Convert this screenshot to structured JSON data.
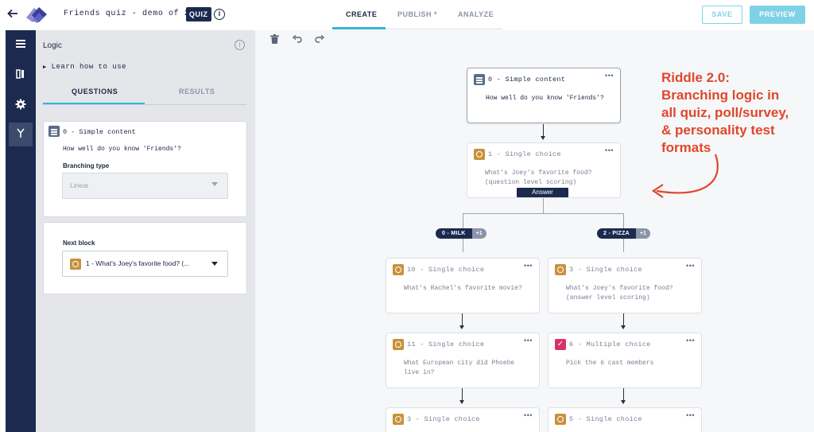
{
  "header": {
    "title": "Friends quiz - demo of 2.0",
    "badge": "QUIZ",
    "info": "i",
    "tabs": [
      "CREATE",
      "PUBLISH *",
      "ANALYZE"
    ],
    "save_label": "SAVE",
    "preview_label": "PREVIEW"
  },
  "colors": {
    "brand_dark": "#1b2a4e",
    "accent": "#37b7d6",
    "button_light": "#7fd2e6",
    "annotation": "#e0472a",
    "single_choice": "#c8913b",
    "multiple_choice": "#d6336c"
  },
  "rail": {
    "icons": [
      "blocks-icon",
      "design-icon",
      "settings-icon",
      "logic-icon"
    ],
    "active": "logic-icon"
  },
  "panel": {
    "title": "Logic",
    "learn": "Learn how to use",
    "tabs": [
      "QUESTIONS",
      "RESULTS"
    ],
    "card1": {
      "title": "0 - Simple content",
      "question": "How well do you know 'Friends'?",
      "branching_label": "Branching type",
      "branching_value": "Linear"
    },
    "card2": {
      "next_label": "Next block",
      "next_value": "1 - What's Joey's favorite food? (..."
    }
  },
  "canvas": {
    "nodes": [
      {
        "id": "n0",
        "title": "0 - Simple content",
        "body": [
          "How well do you know 'Friends'?"
        ],
        "icon": "simple"
      },
      {
        "id": "n1",
        "title": "1 - Single choice",
        "body": [
          "What's Joey's favorite food?",
          "(question level scoring)"
        ],
        "icon": "single"
      },
      {
        "id": "n10",
        "title": "10 - Single choice",
        "body": [
          "What's Rachel's favorite movie?"
        ],
        "icon": "single"
      },
      {
        "id": "n3a",
        "title": "3 - Single choice",
        "body": [
          "What's Joey's favorite food?",
          "(answer level scoring)"
        ],
        "icon": "single"
      },
      {
        "id": "n11",
        "title": "11 - Single choice",
        "body": [
          "What European city did Phoebe",
          "live in?"
        ],
        "icon": "single"
      },
      {
        "id": "n6",
        "title": "6 - Multiple choice",
        "body": [
          "Pick the 6 cast members"
        ],
        "icon": "multi"
      },
      {
        "id": "n3b",
        "title": "3 - Single choice",
        "body": [],
        "icon": "single"
      },
      {
        "id": "n5",
        "title": "5 - Single choice",
        "body": [],
        "icon": "single"
      }
    ],
    "answer_label": "Answer",
    "branches": [
      {
        "label": "0 - MILK",
        "count": "+1"
      },
      {
        "label": "2 - PIZZA",
        "count": "+1"
      }
    ],
    "menu_dots": "•••"
  },
  "annotation": {
    "lines": [
      "Riddle 2.0:",
      "Branching logic in",
      "all quiz, poll/survey,",
      "& personality test",
      "formats"
    ]
  }
}
